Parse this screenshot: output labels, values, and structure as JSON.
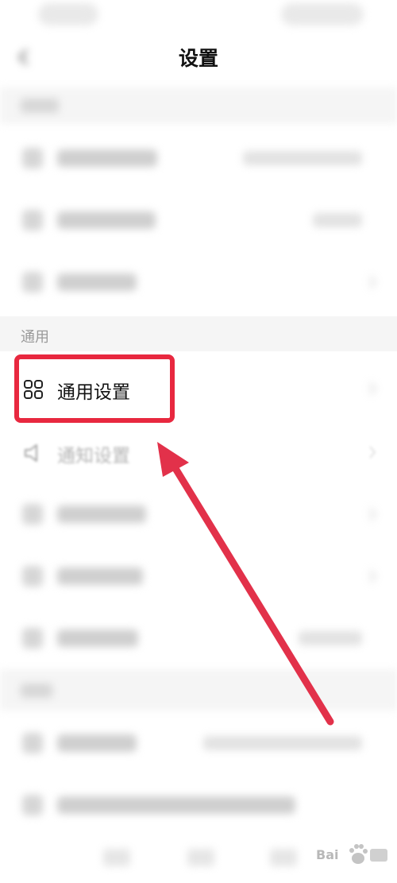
{
  "header": {
    "title": "设置"
  },
  "sections": {
    "general_label": "通用"
  },
  "rows": {
    "general_settings": "通用设置",
    "notification_settings": "通知设置"
  },
  "watermark": {
    "text": "Bai"
  },
  "colors": {
    "highlight": "#e8283f",
    "arrow": "#e2314a"
  }
}
